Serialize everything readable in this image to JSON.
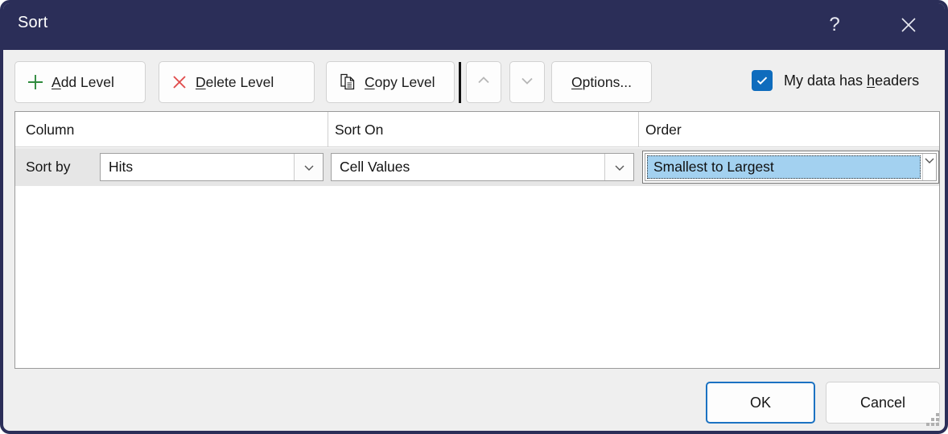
{
  "dialog": {
    "title": "Sort",
    "accent_navy": "#2b2e58",
    "body_background": "#efefef"
  },
  "titlebar": {
    "help_icon": "question-mark-icon",
    "help_label": "?",
    "close_icon": "close-icon"
  },
  "toolbar": {
    "add_level": {
      "label_pre": "",
      "accel": "A",
      "label_post": "dd Level",
      "icon": "plus-icon",
      "icon_color": "#2e8b3d",
      "enabled": true
    },
    "delete_level": {
      "accel": "D",
      "label_post": "elete Level",
      "icon": "cross-icon",
      "icon_color": "#e04b4b",
      "enabled": true
    },
    "copy_level": {
      "accel": "C",
      "label_post": "opy Level",
      "icon": "copy-document-icon",
      "enabled": true
    },
    "move_up": {
      "icon": "chevron-up-icon",
      "enabled": false
    },
    "move_down": {
      "icon": "chevron-down-icon",
      "enabled": false
    },
    "options": {
      "accel": "O",
      "label_post": "ptions...",
      "enabled": true
    },
    "headers_checkbox": {
      "checked": true,
      "label_pre": "My data has ",
      "accel": "h",
      "label_post": "eaders",
      "check_color": "#0f6cbd"
    }
  },
  "list": {
    "columns": [
      "Column",
      "Sort On",
      "Order"
    ],
    "rows": [
      {
        "row_label": "Sort by",
        "column_value": "Hits",
        "sort_on_value": "Cell Values",
        "order_value": "Smallest to Largest",
        "order_focused": true,
        "selection_color": "#a3d1f0"
      }
    ]
  },
  "footer": {
    "ok_label": "OK",
    "cancel_label": "Cancel",
    "default_button": "OK",
    "default_border_color": "#1b72c2",
    "resize_grip": "resize-grip-icon"
  }
}
